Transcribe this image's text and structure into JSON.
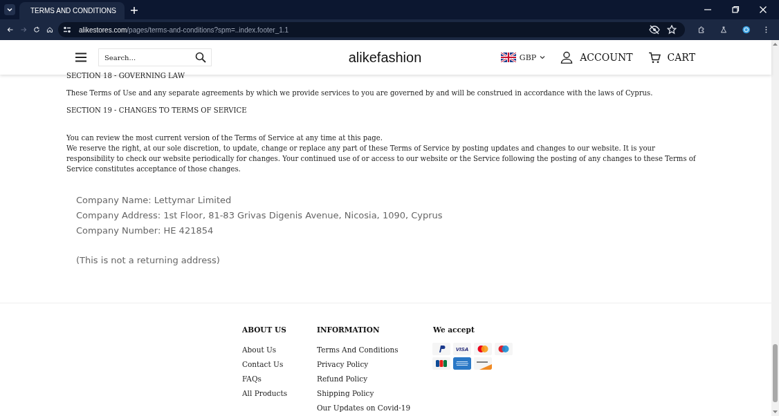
{
  "browser": {
    "tab": {
      "title": "TERMS AND CONDITIONS"
    },
    "url_host": "alikestores.com",
    "url_path": "/pages/terms-and-conditions?spm=..index.footer_1.1",
    "nav_buttons": [
      {
        "kind": "back",
        "disabled": false
      },
      {
        "kind": "forward",
        "disabled": true
      },
      {
        "kind": "reload",
        "disabled": false
      },
      {
        "kind": "home",
        "disabled": false
      }
    ]
  },
  "header": {
    "search": {
      "placeholder": "Search..."
    },
    "logo": "alikefashion",
    "currency": "GBP",
    "account": "ACCOUNT",
    "cart": "CART"
  },
  "content": {
    "blocks": [
      {
        "kind": "heading",
        "text": "SECTION 18 - GOVERNING LAW"
      },
      {
        "kind": "paragraph",
        "text": "These Terms of Use and any separate agreements by which we provide services to you are governed by and will be construed in accordance with the laws of Cyprus."
      },
      {
        "kind": "heading",
        "text": "SECTION 19 - CHANGES TO TERMS OF SERVICE"
      },
      {
        "kind": "spacer"
      },
      {
        "kind": "line",
        "text": "You can review the most current version of the Terms of Service at any time at this page."
      },
      {
        "kind": "line",
        "text": "We reserve the right, at our sole discretion, to update, change or replace any part of these Terms of Service by posting updates and changes to our website. It is your responsibility to check our website periodically for changes. Your continued use of or access to our website or the Service following the posting of any changes to these Terms of Service constitutes acceptance of those changes."
      }
    ],
    "company": [
      "Company Name: Lettymar Limited",
      "Company Address: 1st Floor, 81-83 Grivas Digenis Avenue, Nicosia, 1090, Cyprus",
      "Company Number: HE 421854"
    ],
    "note": "(This is not a returning address)"
  },
  "footer": {
    "columns": [
      {
        "title": "ABOUT US",
        "links": [
          "About Us",
          "Contact Us",
          "FAQs",
          "All Products"
        ]
      },
      {
        "title": "INFORMATION",
        "links": [
          "Terms And Conditions",
          "Privacy Policy",
          "Refund Policy",
          "Shipping Policy",
          "Our Updates on Covid-19"
        ]
      }
    ],
    "payments": {
      "title": "We accept",
      "methods": [
        {
          "kind": "paypal"
        },
        {
          "kind": "visa",
          "label": "VISA"
        },
        {
          "kind": "mastercard"
        },
        {
          "kind": "maestro"
        },
        {
          "kind": "jcb"
        },
        {
          "kind": "amex"
        },
        {
          "kind": "discover"
        }
      ]
    }
  }
}
